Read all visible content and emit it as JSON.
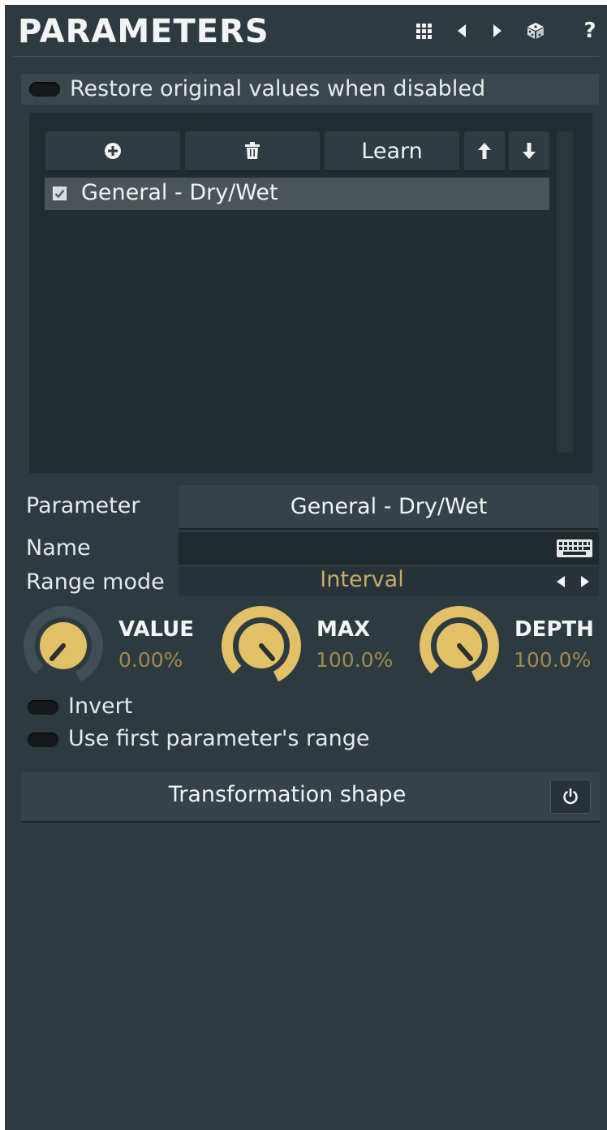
{
  "header": {
    "title": "PARAMETERS",
    "icons": [
      "grid-icon",
      "prev-arrow-icon",
      "next-arrow-icon",
      "dice-icon",
      "help-icon"
    ],
    "help_label": "?"
  },
  "restore": {
    "label": "Restore original values when disabled",
    "enabled": false
  },
  "list_toolbar": {
    "add_icon": "plus-circle-icon",
    "delete_icon": "trash-icon",
    "learn_label": "Learn",
    "up_icon": "arrow-up-icon",
    "down_icon": "arrow-down-icon"
  },
  "list": {
    "items": [
      {
        "label": "General - Dry/Wet",
        "checked": true
      }
    ]
  },
  "parameter": {
    "label": "Parameter",
    "value": "General - Dry/Wet"
  },
  "name": {
    "label": "Name",
    "value": ""
  },
  "range_mode": {
    "label": "Range mode",
    "value": "Interval"
  },
  "knobs": [
    {
      "title": "VALUE",
      "value": "0.00%",
      "fraction": 0.0
    },
    {
      "title": "MAX",
      "value": "100.0%",
      "fraction": 1.0
    },
    {
      "title": "DEPTH",
      "value": "100.0%",
      "fraction": 1.0
    }
  ],
  "options": {
    "invert": {
      "label": "Invert",
      "enabled": false
    },
    "first_range": {
      "label": "Use first parameter's range",
      "enabled": false
    }
  },
  "transformation": {
    "label": "Transformation shape",
    "power_icon": "power-icon"
  },
  "colors": {
    "panel": "#2d3a40",
    "accent": "#e2c068",
    "value_text": "#a18a52"
  }
}
